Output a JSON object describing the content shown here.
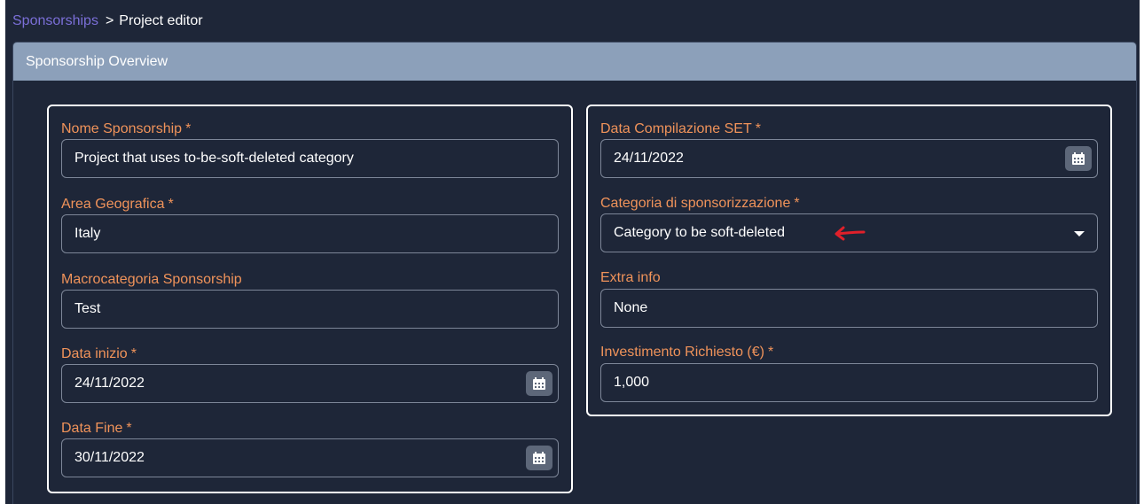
{
  "breadcrumb": {
    "link": "Sponsorships",
    "separator": ">",
    "current": "Project editor"
  },
  "panel": {
    "title": "Sponsorship Overview"
  },
  "left_card": {
    "nome": {
      "label": "Nome Sponsorship",
      "required": "*",
      "value": "Project that uses to-be-soft-deleted category"
    },
    "area": {
      "label": "Area Geografica",
      "required": "*",
      "value": "Italy"
    },
    "macro": {
      "label": "Macrocategoria Sponsorship",
      "value": "Test"
    },
    "inizio": {
      "label": "Data inizio",
      "required": "*",
      "value": "24/11/2022",
      "icon": "calendar-icon"
    },
    "fine": {
      "label": "Data Fine",
      "required": "*",
      "value": "30/11/2022",
      "icon": "calendar-icon"
    }
  },
  "right_card": {
    "compilazione": {
      "label": "Data Compilazione SET",
      "required": "*",
      "value": "24/11/2022",
      "icon": "calendar-icon"
    },
    "categoria": {
      "label": "Categoria di sponsorizzazione",
      "required": "*",
      "value": "Category to be soft-deleted",
      "icon": "chevron-down-icon"
    },
    "extra": {
      "label": "Extra info",
      "value": "None"
    },
    "investimento": {
      "label": "Investimento Richiesto (€)",
      "required": "*",
      "value": "1,000"
    }
  },
  "annotation": {
    "icon": "red-arrow-icon",
    "color": "#e0202a"
  },
  "colors": {
    "background": "#1e2638",
    "header": "#8ca0ba",
    "label": "#f0935a",
    "link": "#7b6fd8"
  }
}
